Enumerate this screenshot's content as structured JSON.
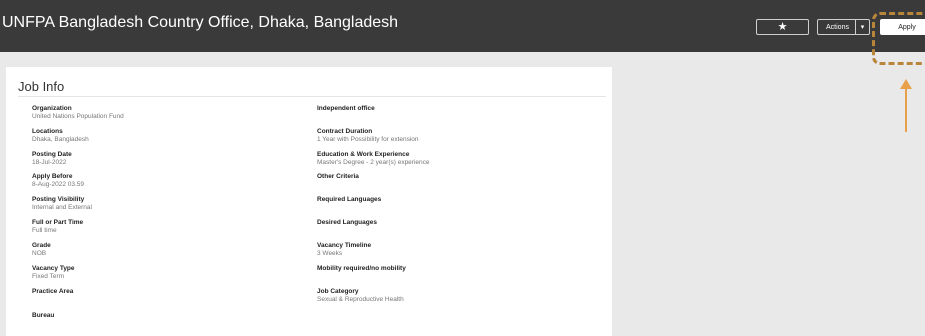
{
  "header": {
    "title": "UNFPA Bangladesh Country Office, Dhaka, Bangladesh",
    "star_icon": "★",
    "actions_label": "Actions",
    "actions_caret": "▾",
    "apply_label": "Apply"
  },
  "colors": {
    "header_bg": "#3a3a3a",
    "highlight": "#b8863b",
    "arrow": "#e8a04a"
  },
  "job_info": {
    "title": "Job Info",
    "left_fields": [
      {
        "label": "Organization",
        "value": "United Nations Population Fund"
      },
      {
        "label": "Locations",
        "value": "Dhaka, Bangladesh"
      },
      {
        "label": "Posting Date",
        "value": "18-Jul-2022"
      },
      {
        "label": "Apply Before",
        "value": "8-Aug-2022 03.59"
      },
      {
        "label": "Posting Visibility",
        "value": "Internal and External"
      },
      {
        "label": "Full or Part Time",
        "value": "Full time"
      },
      {
        "label": "Grade",
        "value": "NOB"
      },
      {
        "label": "Vacancy Type",
        "value": "Fixed Term"
      },
      {
        "label": "Practice Area",
        "value": ""
      },
      {
        "label": "Bureau",
        "value": ""
      }
    ],
    "right_fields": [
      {
        "label": "Independent office",
        "value": ""
      },
      {
        "label": "Contract Duration",
        "value": "1 Year with Possibility for extension"
      },
      {
        "label": "Education & Work Experience",
        "value": "Master's Degree - 2 year(s) experience"
      },
      {
        "label": "Other Criteria",
        "value": ""
      },
      {
        "label": "Required Languages",
        "value": ""
      },
      {
        "label": "Desired Languages",
        "value": ""
      },
      {
        "label": "Vacancy Timeline",
        "value": "3 Weeks"
      },
      {
        "label": "Mobility required/no mobility",
        "value": ""
      },
      {
        "label": "Job Category",
        "value": "Sexual & Reproductive Health"
      }
    ]
  }
}
